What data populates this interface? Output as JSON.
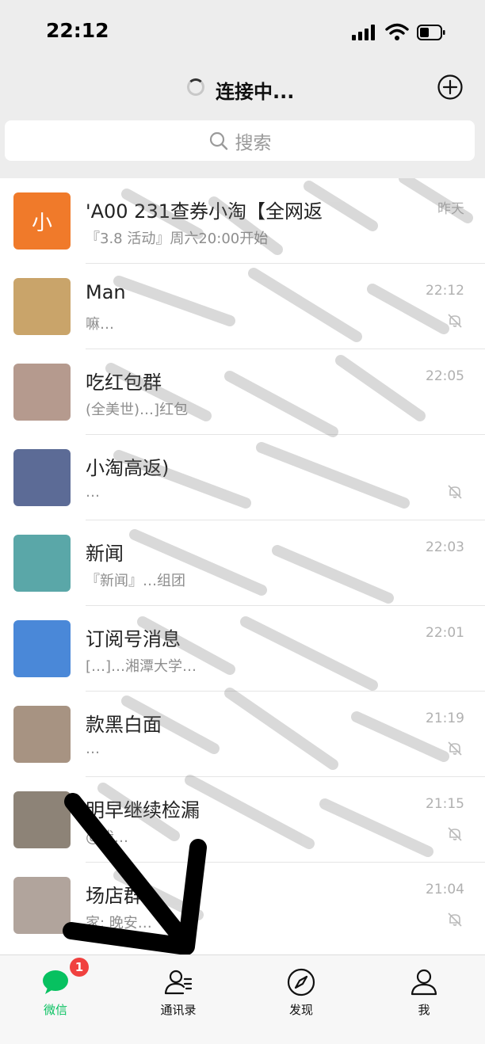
{
  "status_bar": {
    "time": "22:12"
  },
  "nav": {
    "title": "连接中..."
  },
  "search": {
    "placeholder": "搜索"
  },
  "chats": [
    {
      "name": "'A00 231查券小淘【全网返",
      "preview": "『3.8 活动』周六20:00开始",
      "time": "昨天",
      "muted": false,
      "avatar_color": "#f07a2a",
      "avatar_text": "小"
    },
    {
      "name": "Man",
      "preview": "嘛…",
      "time": "22:12",
      "muted": true,
      "avatar_color": "#c9a46a",
      "avatar_text": ""
    },
    {
      "name": "吃红包群",
      "preview": "(全美世)…]红包",
      "time": "22:05",
      "muted": false,
      "avatar_color": "#b59a8e",
      "avatar_text": ""
    },
    {
      "name": "小淘高返)",
      "preview": "…",
      "time": "",
      "muted": true,
      "avatar_color": "#5c6b96",
      "avatar_text": ""
    },
    {
      "name": "新闻",
      "preview": "『新闻』…组团",
      "time": "22:03",
      "muted": false,
      "avatar_color": "#5aa7a8",
      "avatar_text": ""
    },
    {
      "name": "订阅号消息",
      "preview": "[…]…湘潭大学…",
      "time": "22:01",
      "muted": false,
      "avatar_color": "#4a88d8",
      "avatar_text": ""
    },
    {
      "name": "款黑白面",
      "preview": "…",
      "time": "21:19",
      "muted": true,
      "avatar_color": "#a79382",
      "avatar_text": ""
    },
    {
      "name": "明早继续检漏",
      "preview": "@我…",
      "time": "21:15",
      "muted": true,
      "avatar_color": "#8d8377",
      "avatar_text": ""
    },
    {
      "name": "场店群",
      "preview": "家: 晚安…",
      "time": "21:04",
      "muted": true,
      "avatar_color": "#b1a49c",
      "avatar_text": ""
    }
  ],
  "tabs": [
    {
      "label": "微信",
      "active": true,
      "badge": "1"
    },
    {
      "label": "通讯录",
      "active": false
    },
    {
      "label": "发现",
      "active": false
    },
    {
      "label": "我",
      "active": false
    }
  ],
  "colors": {
    "accent": "#07c160",
    "badge": "#f0413f"
  }
}
